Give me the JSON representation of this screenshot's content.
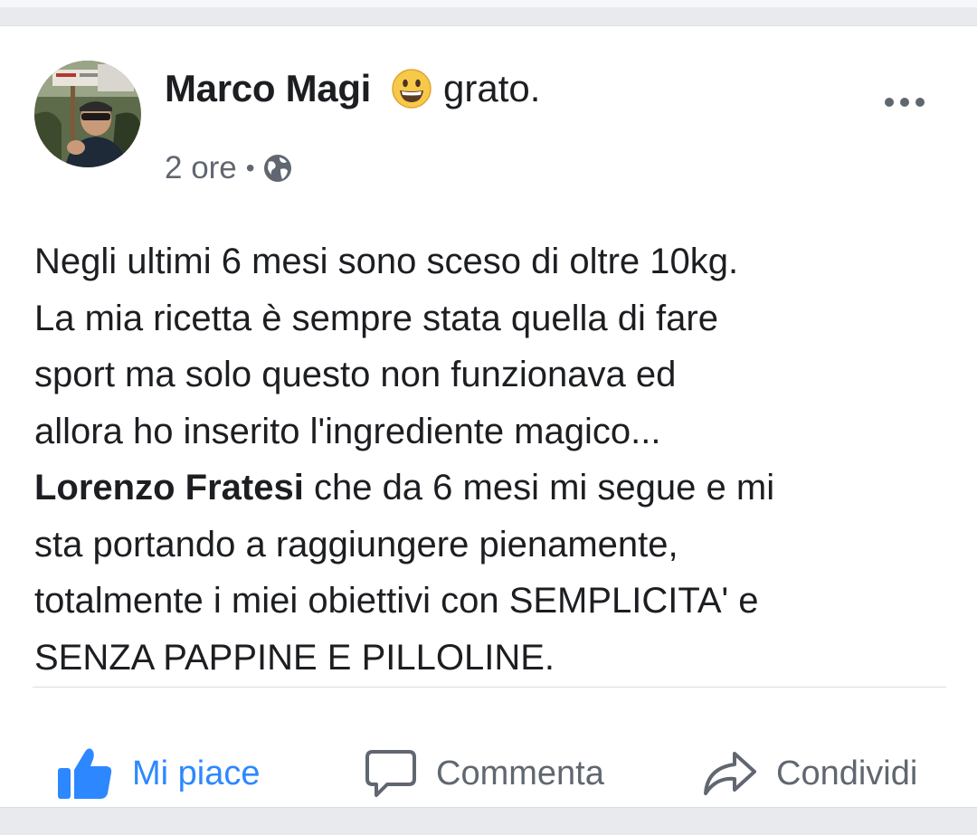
{
  "post": {
    "author": "Marco Magi",
    "feeling_icon": "grinning-face-emoji",
    "feeling_text": "grato.",
    "time": "2 ore",
    "separator": "•",
    "audience_icon": "globe-icon",
    "more_icon": "ellipsis-icon",
    "body": {
      "line1": "Negli ultimi 6 mesi sono sceso di oltre 10kg.",
      "line2": "La mia ricetta è sempre stata quella di fare",
      "line3": "sport ma solo questo non funzionava ed",
      "line4": "allora ho inserito l'ingrediente magico...",
      "mention": "Lorenzo Fratesi",
      "line5_rest": " che da 6 mesi mi segue e mi",
      "line6": "sta portando a raggiungere pienamente,",
      "line7": "totalmente i miei obiettivi con SEMPLICITA' e",
      "line8": "SENZA PAPPINE E PILLOLINE."
    }
  },
  "actions": {
    "like_label": "Mi piace",
    "comment_label": "Commenta",
    "share_label": "Condividi"
  },
  "colors": {
    "like_blue": "#2d88ff",
    "secondary_text": "#606770",
    "primary_text": "#1c1e21"
  }
}
